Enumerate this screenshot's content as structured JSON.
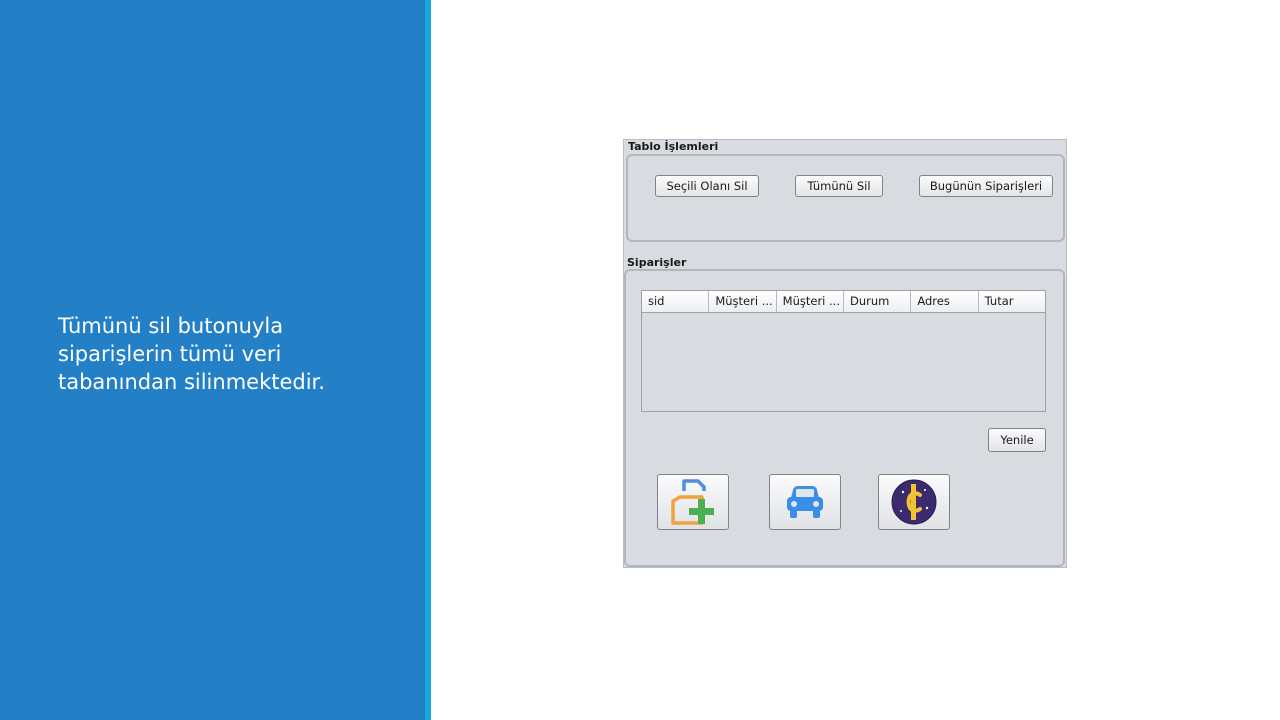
{
  "slide": {
    "description_text": "Tümünü sil butonuyla\nsiparişlerin tümü veri\ntabanından silinmektedir."
  },
  "window": {
    "table_ops": {
      "title": "Tablo İşlemleri",
      "buttons": {
        "delete_selected": "Seçili Olanı Sil",
        "delete_all": "Tümünü Sil",
        "todays_orders": "Bugünün Siparişleri"
      }
    },
    "orders": {
      "title": "Siparişler",
      "columns": [
        "sid",
        "Müşteri ...",
        "Müşteri ...",
        "Durum",
        "Adres",
        "Tutar"
      ],
      "rows": [],
      "refresh_label": "Yenile"
    },
    "icon_buttons": [
      {
        "icon": "add-file-icon",
        "colors": [
          "#4f8fdc",
          "#f0a23c",
          "#4cb050"
        ]
      },
      {
        "icon": "car-icon",
        "colors": [
          "#3a8ee6"
        ]
      },
      {
        "icon": "coin-logo-icon",
        "colors": [
          "#3b2a6e",
          "#f2c230"
        ]
      }
    ]
  },
  "colors": {
    "panel_blue": "#2480c6",
    "accent_cyan": "#1aa6de",
    "window_bg": "#d8dbe0"
  }
}
